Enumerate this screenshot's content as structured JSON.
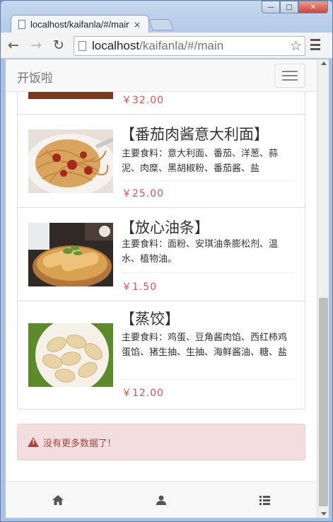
{
  "browser": {
    "tab_title": "localhost/kaifanla/#/main",
    "tab_close": "×",
    "url_host": "localhost",
    "url_path": "/kaifanla/#/main",
    "minimize": "—",
    "maximize": "□",
    "close": "✕",
    "back": "←",
    "forward": "→",
    "reload": "↻",
    "star": "☆"
  },
  "navbar": {
    "brand": "开饭啦"
  },
  "items": [
    {
      "name": "",
      "desc": "",
      "price": "￥32.00"
    },
    {
      "name": "【番茄肉酱意大利面】",
      "desc": "主要食料：意大利面、番茄、洋葱、蒜泥、肉糜、黑胡椒粉、番茄酱、盐",
      "price": "￥25.00"
    },
    {
      "name": "【放心油条】",
      "desc": "主要食料：面粉、安琪油条膨松剂、温水、植物油。",
      "price": "￥1.50"
    },
    {
      "name": "【蒸饺】",
      "desc": "主要食料：鸡蛋、豆角酱肉馅、西红柿鸡蛋馅、猪生抽、生抽、海鲜酱油、糖、盐",
      "price": "￥12.00"
    }
  ],
  "alert": {
    "text": "没有更多数据了!"
  },
  "bottom_nav": [
    "home-icon",
    "user-icon",
    "list-icon"
  ]
}
